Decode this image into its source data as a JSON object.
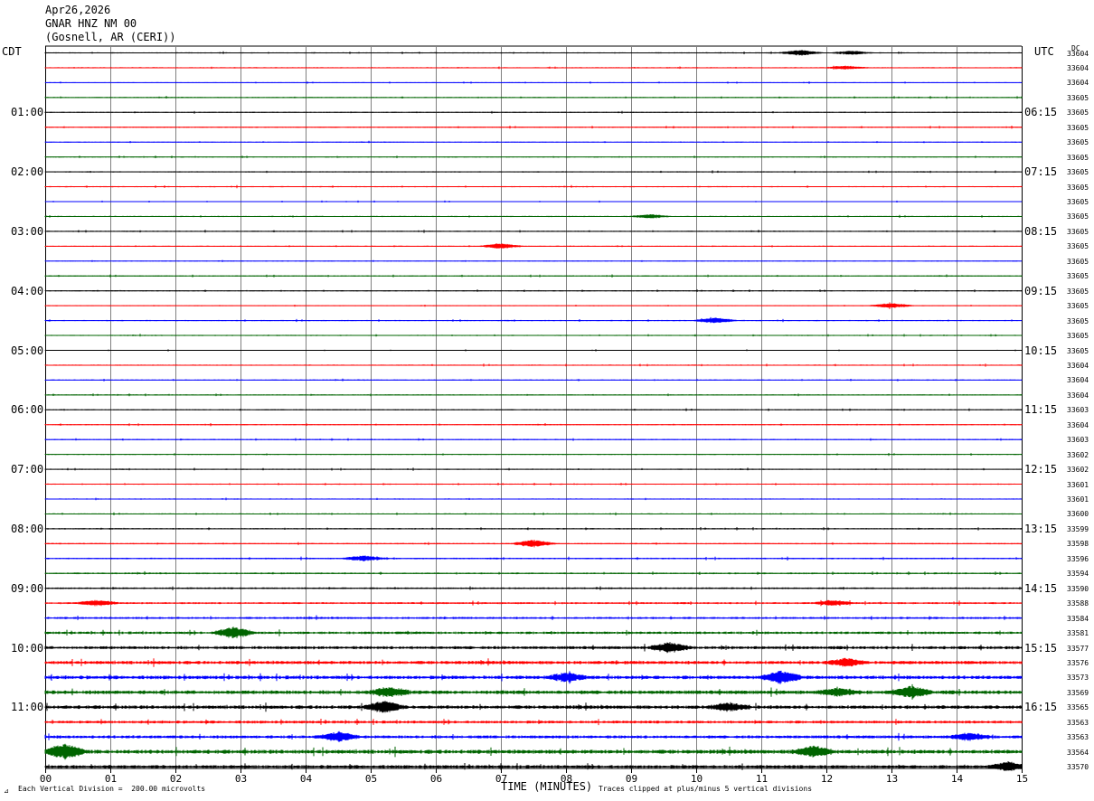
{
  "header": {
    "date": "Apr26,2026",
    "station": "GNAR HNZ NM 00",
    "location": "(Gosnell, AR (CERI))"
  },
  "left_tz": "CDT",
  "right_tz": "UTC",
  "dc_label": "DC",
  "footer": {
    "scale_note": "Each Vertical Division =  200.00 microvolts",
    "xlabel": "TIME (MINUTES)",
    "clip_note": "Traces clipped at plus/minus 5 vertical divisions"
  },
  "colors": {
    "cycle": [
      "#000000",
      "#ff0000",
      "#0000ff",
      "#006400"
    ],
    "grid_vertical": "#808080",
    "grid_hour": "#000000"
  },
  "chart_data": {
    "type": "line",
    "xlabel": "TIME (MINUTES)",
    "xlim": [
      0,
      15
    ],
    "x_ticks": [
      "00",
      "01",
      "02",
      "03",
      "04",
      "05",
      "06",
      "07",
      "08",
      "09",
      "10",
      "11",
      "12",
      "13",
      "14",
      "15"
    ],
    "left_hour_labels": [
      "01:00",
      "02:00",
      "03:00",
      "04:00",
      "05:00",
      "06:00",
      "07:00",
      "08:00",
      "09:00",
      "10:00",
      "11:00"
    ],
    "right_hour_labels": [
      "06:15",
      "07:15",
      "08:15",
      "09:15",
      "10:15",
      "11:15",
      "12:15",
      "13:15",
      "14:15",
      "15:15",
      "16:15"
    ],
    "dc_offsets": [
      33604,
      33604,
      33604,
      33605,
      33605,
      33605,
      33605,
      33605,
      33605,
      33605,
      33605,
      33605,
      33605,
      33605,
      33605,
      33605,
      33605,
      33605,
      33605,
      33605,
      33605,
      33604,
      33604,
      33604,
      33603,
      33604,
      33603,
      33602,
      33602,
      33601,
      33601,
      33600,
      33599,
      33598,
      33596,
      33594,
      33590,
      33588,
      33584,
      33581,
      33577,
      33576,
      33573,
      33569,
      33565,
      33563,
      33563,
      33564,
      33570
    ],
    "trace_amplitude_level": [
      1,
      1,
      0.8,
      1,
      1,
      1,
      0.8,
      1,
      1,
      1,
      0.8,
      1,
      1,
      0.8,
      0.8,
      1,
      1,
      0.8,
      1,
      1,
      0.8,
      1,
      1,
      1,
      1,
      1,
      1,
      1,
      1,
      1,
      1,
      1,
      1.2,
      1.2,
      1.3,
      1.4,
      1.5,
      1.6,
      1.8,
      2.2,
      2.6,
      2.8,
      3,
      3.2,
      3,
      2.4,
      2.6,
      3.4,
      2.6
    ],
    "events": [
      {
        "trace": 0,
        "minute": 11.6,
        "size": 3
      },
      {
        "trace": 0,
        "minute": 12.4,
        "size": 2
      },
      {
        "trace": 1,
        "minute": 12.3,
        "size": 2
      },
      {
        "trace": 11,
        "minute": 9.3,
        "size": 2
      },
      {
        "trace": 13,
        "minute": 7.0,
        "size": 3
      },
      {
        "trace": 17,
        "minute": 13.0,
        "size": 3
      },
      {
        "trace": 18,
        "minute": 10.3,
        "size": 3
      },
      {
        "trace": 33,
        "minute": 7.5,
        "size": 4
      },
      {
        "trace": 34,
        "minute": 4.9,
        "size": 3
      },
      {
        "trace": 37,
        "minute": 0.8,
        "size": 3
      },
      {
        "trace": 37,
        "minute": 12.1,
        "size": 3
      },
      {
        "trace": 39,
        "minute": 2.9,
        "size": 6
      },
      {
        "trace": 40,
        "minute": 9.6,
        "size": 5
      },
      {
        "trace": 41,
        "minute": 12.3,
        "size": 4
      },
      {
        "trace": 42,
        "minute": 8.0,
        "size": 4
      },
      {
        "trace": 42,
        "minute": 11.3,
        "size": 7
      },
      {
        "trace": 43,
        "minute": 5.3,
        "size": 5
      },
      {
        "trace": 43,
        "minute": 12.2,
        "size": 4
      },
      {
        "trace": 43,
        "minute": 13.3,
        "size": 6
      },
      {
        "trace": 44,
        "minute": 5.2,
        "size": 6
      },
      {
        "trace": 44,
        "minute": 10.5,
        "size": 4
      },
      {
        "trace": 46,
        "minute": 4.5,
        "size": 5
      },
      {
        "trace": 46,
        "minute": 14.2,
        "size": 4
      },
      {
        "trace": 47,
        "minute": 0.3,
        "size": 8
      },
      {
        "trace": 47,
        "minute": 11.8,
        "size": 6
      },
      {
        "trace": 48,
        "minute": 14.8,
        "size": 5
      }
    ]
  }
}
